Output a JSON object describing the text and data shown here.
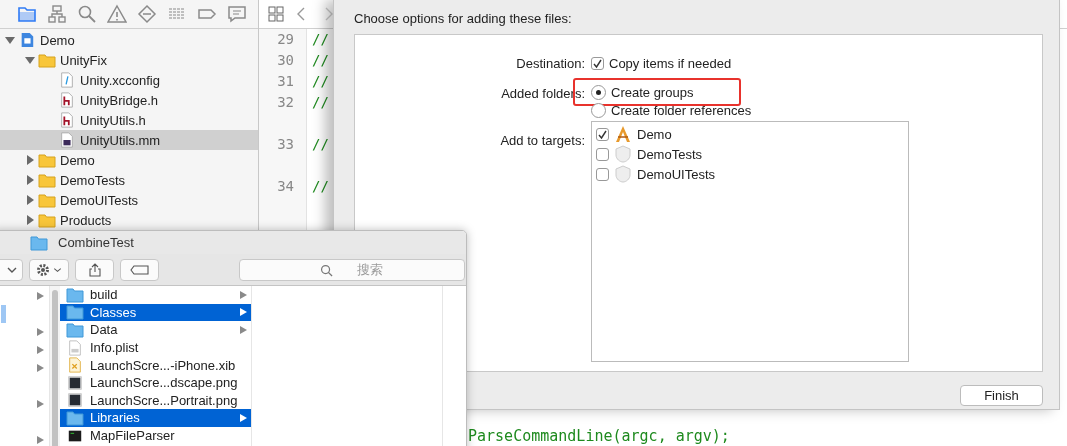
{
  "navigator": {
    "tabs": [
      {
        "kind": "folder",
        "selected": true
      },
      {
        "kind": "hierarchy",
        "selected": false
      },
      {
        "kind": "search",
        "selected": false
      },
      {
        "kind": "warning",
        "selected": false
      },
      {
        "kind": "diamond",
        "selected": false
      },
      {
        "kind": "list",
        "selected": false
      },
      {
        "kind": "tag",
        "selected": false
      },
      {
        "kind": "chat",
        "selected": false
      }
    ],
    "tree": [
      {
        "label": "Demo",
        "kind": "project",
        "expanded": true,
        "selected": false,
        "children": [
          {
            "label": "UnityFix",
            "kind": "folder",
            "expanded": true,
            "selected": false,
            "children": [
              {
                "label": "Unity.xcconfig",
                "kind": "config",
                "selected": false
              },
              {
                "label": "UnityBridge.h",
                "kind": "header",
                "selected": false
              },
              {
                "label": "UnityUtils.h",
                "kind": "header",
                "selected": false
              },
              {
                "label": "UnityUtils.mm",
                "kind": "source",
                "selected": true
              }
            ]
          },
          {
            "label": "Demo",
            "kind": "folder",
            "expanded": false,
            "selected": false
          },
          {
            "label": "DemoTests",
            "kind": "folder",
            "expanded": false,
            "selected": false
          },
          {
            "label": "DemoUITests",
            "kind": "folder",
            "expanded": false,
            "selected": false
          },
          {
            "label": "Products",
            "kind": "folder",
            "expanded": false,
            "selected": false
          }
        ]
      }
    ]
  },
  "editor": {
    "lines": [
      {
        "number": "29",
        "code": "//"
      },
      {
        "number": "30",
        "code": "//"
      },
      {
        "number": "31",
        "code": "//"
      },
      {
        "number": "32",
        "code": "//"
      },
      {
        "number": "33",
        "code": "//"
      },
      {
        "number": "34",
        "code": "//"
      }
    ],
    "bottom_code": "ParseCommandLine(argc, argv);"
  },
  "sheet": {
    "title": "Choose options for adding these files:",
    "destination": {
      "label": "Destination:",
      "option": "Copy items if needed",
      "checked": true
    },
    "added_folders": {
      "label": "Added folders:",
      "options": [
        {
          "label": "Create groups",
          "selected": true,
          "highlighted": true
        },
        {
          "label": "Create folder references",
          "selected": false,
          "highlighted": false
        }
      ]
    },
    "targets": {
      "label": "Add to targets:",
      "items": [
        {
          "label": "Demo",
          "kind": "app",
          "checked": true
        },
        {
          "label": "DemoTests",
          "kind": "test",
          "checked": false
        },
        {
          "label": "DemoUITests",
          "kind": "test",
          "checked": false
        }
      ]
    },
    "finish_button": "Finish"
  },
  "finder": {
    "title": "CombineTest",
    "search": {
      "placeholder": "搜索"
    },
    "column_1": [
      {
        "has_children": true,
        "selected": false
      },
      {
        "has_children": false,
        "selected": true
      },
      {
        "has_children": true,
        "selected": false
      },
      {
        "has_children": true,
        "selected": false
      },
      {
        "has_children": true,
        "selected": false
      },
      {
        "has_children": false,
        "selected": false
      },
      {
        "has_children": true,
        "selected": false
      },
      {
        "has_children": false,
        "selected": false
      },
      {
        "has_children": true,
        "selected": false
      }
    ],
    "column_2": [
      {
        "label": "build",
        "kind": "folder",
        "selected": false
      },
      {
        "label": "Classes",
        "kind": "folder",
        "selected": true
      },
      {
        "label": "Data",
        "kind": "folder",
        "selected": false
      },
      {
        "label": "Info.plist",
        "kind": "plist",
        "selected": false
      },
      {
        "label": "LaunchScre...-iPhone.xib",
        "kind": "xib",
        "selected": false
      },
      {
        "label": "LaunchScre...dscape.png",
        "kind": "image",
        "selected": false
      },
      {
        "label": "LaunchScre...Portrait.png",
        "kind": "image",
        "selected": false
      },
      {
        "label": "Libraries",
        "kind": "folder",
        "selected": true
      },
      {
        "label": "MapFileParser",
        "kind": "exec",
        "selected": false
      }
    ]
  }
}
